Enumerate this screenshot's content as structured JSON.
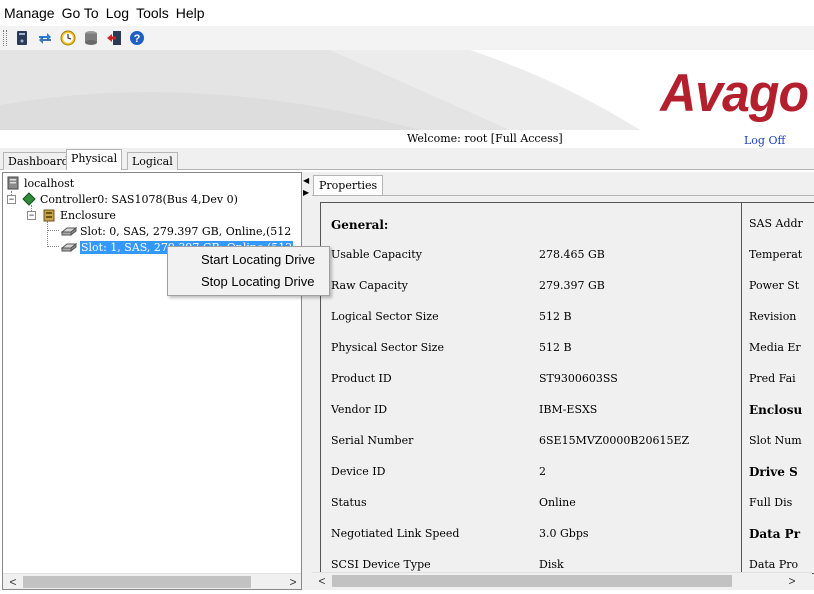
{
  "menu": [
    "Manage",
    "Go To",
    "Log",
    "Tools",
    "Help"
  ],
  "toolbar": {
    "icons": [
      "server-icon",
      "refresh-icon",
      "clock-icon",
      "database-icon",
      "exit-icon",
      "help-icon"
    ]
  },
  "banner": {
    "logo": "Avago",
    "brand_color": "#b41f2e"
  },
  "welcome": {
    "text": "Welcome: root [Full Access]",
    "logoff": "Log Off"
  },
  "tabs": [
    "Dashboard",
    "Physical",
    "Logical"
  ],
  "active_tab": "Physical",
  "tree": {
    "host": "localhost",
    "controller": "Controller0: SAS1078(Bus 4,Dev 0)",
    "enclosure": "Enclosure",
    "slot0": "Slot: 0, SAS, 279.397 GB, Online,(512",
    "slot1": "Slot: 1, SAS, 279.397 GB, Online,(512"
  },
  "context_menu": [
    "Start Locating Drive",
    "Stop Locating Drive"
  ],
  "properties_tab": "Properties",
  "properties": {
    "section": "General:",
    "rows": [
      {
        "key": "Usable Capacity",
        "value": "278.465 GB"
      },
      {
        "key": "Raw Capacity",
        "value": "279.397 GB"
      },
      {
        "key": "Logical Sector Size",
        "value": "512 B"
      },
      {
        "key": "Physical Sector Size",
        "value": "512 B"
      },
      {
        "key": "Product ID",
        "value": "ST9300603SS"
      },
      {
        "key": "Vendor ID",
        "value": "IBM-ESXS"
      },
      {
        "key": "Serial Number",
        "value": "6SE15MVZ0000B20615EZ"
      },
      {
        "key": "Device ID",
        "value": "2"
      },
      {
        "key": "Status",
        "value": "Online"
      },
      {
        "key": "Negotiated Link Speed",
        "value": "3.0 Gbps"
      },
      {
        "key": "SCSI Device Type",
        "value": "Disk"
      }
    ]
  },
  "right_column": [
    {
      "text": "SAS Addr",
      "bold": false
    },
    {
      "text": "Temperat",
      "bold": false
    },
    {
      "text": "Power St",
      "bold": false
    },
    {
      "text": "Revision",
      "bold": false
    },
    {
      "text": "Media Er",
      "bold": false
    },
    {
      "text": "Pred Fai",
      "bold": false
    },
    {
      "text": "Enclosu",
      "bold": true
    },
    {
      "text": "Slot Num",
      "bold": false
    },
    {
      "text": "Drive S",
      "bold": true
    },
    {
      "text": "Full Dis",
      "bold": false
    },
    {
      "text": "Data Pr",
      "bold": true
    },
    {
      "text": "Data Pro",
      "bold": false
    }
  ],
  "scroll": {
    "left": "<",
    "right": ">"
  }
}
